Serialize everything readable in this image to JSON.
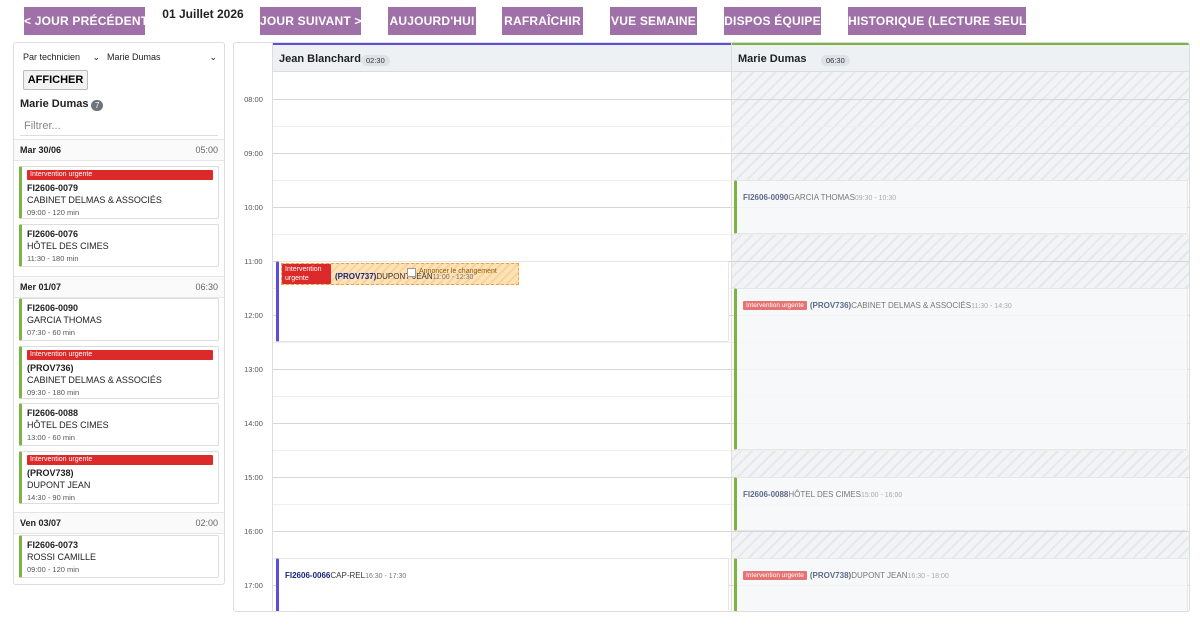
{
  "toolbar": {
    "prev": "< JOUR PRÉCÉDENT",
    "date": "01 Juillet 2026",
    "next": "JOUR SUIVANT >",
    "today": "AUJOURD'HUI",
    "refresh": "RAFRAÎCHIR",
    "week": "VUE SEMAINE",
    "team": "DISPOS ÉQUIPE",
    "history": "HISTORIQUE (LECTURE SEULE)",
    "button_color": "#a070a8"
  },
  "sidebar": {
    "mode_select": "Par technicien",
    "tech_select": "Marie Dumas",
    "show_button": "AFFICHER",
    "tech_name": "Marie Dumas",
    "count": "7",
    "filter_placeholder": "Filtrer...",
    "days": [
      {
        "label": "Mar 30/06",
        "total": "05:00",
        "items": [
          {
            "urgent": "Intervention urgente",
            "ref": "FI2606-0079",
            "client": "CABINET DELMAS & ASSOCIÉS",
            "time": "09:00 - 120 min"
          },
          {
            "urgent": "",
            "ref": "FI2606-0076",
            "client": "HÔTEL DES CIMES",
            "time": "11:30 - 180 min"
          }
        ]
      },
      {
        "label": "Mer 01/07",
        "total": "06:30",
        "items": [
          {
            "urgent": "",
            "ref": "FI2606-0090",
            "client": "GARCIA THOMAS",
            "time": "07:30 - 60 min"
          },
          {
            "urgent": "Intervention urgente",
            "ref": "(PROV736)",
            "client": "CABINET DELMAS & ASSOCIÉS",
            "time": "09:30 - 180 min"
          },
          {
            "urgent": "",
            "ref": "FI2606-0088",
            "client": "HÔTEL DES CIMES",
            "time": "13:00 - 60 min"
          },
          {
            "urgent": "Intervention urgente",
            "ref": "(PROV738)",
            "client": "DUPONT JEAN",
            "time": "14:30 - 90 min"
          }
        ]
      },
      {
        "label": "Ven 03/07",
        "total": "02:00",
        "items": [
          {
            "urgent": "",
            "ref": "FI2606-0073",
            "client": "ROSSI CAMILLE",
            "time": "09:00 - 120 min"
          }
        ]
      }
    ]
  },
  "calendar": {
    "hours": [
      "08:00",
      "09:00",
      "10:00",
      "11:00",
      "12:00",
      "13:00",
      "14:00",
      "15:00",
      "16:00",
      "17:00"
    ],
    "columns": [
      {
        "name": "Jean Blanchard",
        "total": "02:30",
        "accent": "#5c4ed8",
        "events": [
          {
            "urgent": "Intervention urgente",
            "ref": "(PROV737)",
            "client": "DUPONT JEAN",
            "time": "11:00 - 12:30",
            "note": "Annoncer le changement"
          },
          {
            "urgent": "",
            "ref": "FI2606-0066",
            "client": "CAP-REL",
            "time": "16:30 - 17:30"
          }
        ]
      },
      {
        "name": "Marie Dumas",
        "total": "06:30",
        "accent": "#7cb342",
        "events": [
          {
            "urgent": "",
            "ref": "FI2606-0090",
            "client": "GARCIA THOMAS",
            "time": "09:30 - 10:30"
          },
          {
            "urgent": "Intervention urgente",
            "ref": "(PROV736)",
            "client": "CABINET DELMAS & ASSOCIÉS",
            "time": "11:30 - 14:30"
          },
          {
            "urgent": "",
            "ref": "FI2606-0088",
            "client": "HÔTEL DES CIMES",
            "time": "15:00 - 16:00"
          },
          {
            "urgent": "Intervention urgente",
            "ref": "(PROV738)",
            "client": "DUPONT JEAN",
            "time": "16:30 - 18:00"
          }
        ]
      }
    ]
  }
}
